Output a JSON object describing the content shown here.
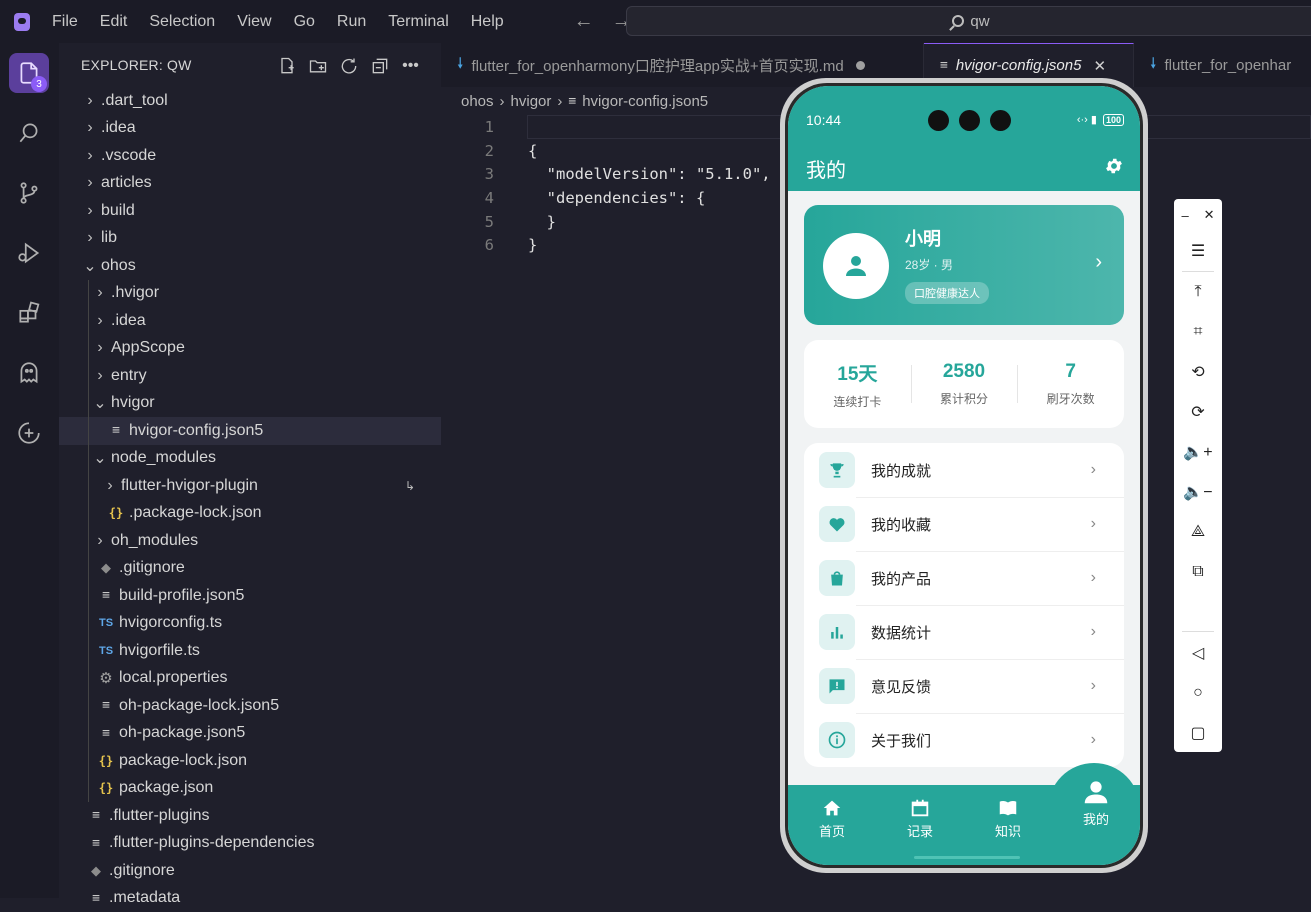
{
  "menubar": [
    "File",
    "Edit",
    "Selection",
    "View",
    "Go",
    "Run",
    "Terminal",
    "Help"
  ],
  "search": {
    "text": "qw"
  },
  "activity": {
    "badge": "3"
  },
  "explorer": {
    "title": "EXPLORER: QW",
    "items": [
      {
        "label": ".dart_tool",
        "type": "folder",
        "open": false,
        "depth": 0
      },
      {
        "label": ".idea",
        "type": "folder",
        "open": false,
        "depth": 0
      },
      {
        "label": ".vscode",
        "type": "folder",
        "open": false,
        "depth": 0
      },
      {
        "label": "articles",
        "type": "folder",
        "open": false,
        "depth": 0
      },
      {
        "label": "build",
        "type": "folder",
        "open": false,
        "depth": 0
      },
      {
        "label": "lib",
        "type": "folder",
        "open": false,
        "depth": 0
      },
      {
        "label": "ohos",
        "type": "folder",
        "open": true,
        "depth": 0
      },
      {
        "label": ".hvigor",
        "type": "folder",
        "open": false,
        "depth": 1
      },
      {
        "label": ".idea",
        "type": "folder",
        "open": false,
        "depth": 1
      },
      {
        "label": "AppScope",
        "type": "folder",
        "open": false,
        "depth": 1
      },
      {
        "label": "entry",
        "type": "folder",
        "open": false,
        "depth": 1
      },
      {
        "label": "hvigor",
        "type": "folder",
        "open": true,
        "depth": 1
      },
      {
        "label": "hvigor-config.json5",
        "type": "lines",
        "depth": 2,
        "selected": true
      },
      {
        "label": "node_modules",
        "type": "folder",
        "open": true,
        "depth": 1
      },
      {
        "label": "flutter-hvigor-plugin",
        "type": "folder",
        "open": false,
        "depth": 2,
        "link": true
      },
      {
        "label": ".package-lock.json",
        "type": "braces",
        "depth": 2
      },
      {
        "label": "oh_modules",
        "type": "folder",
        "open": false,
        "depth": 1
      },
      {
        "label": ".gitignore",
        "type": "git",
        "depth": 1
      },
      {
        "label": "build-profile.json5",
        "type": "lines",
        "depth": 1
      },
      {
        "label": "hvigorconfig.ts",
        "type": "ts",
        "depth": 1
      },
      {
        "label": "hvigorfile.ts",
        "type": "ts",
        "depth": 1
      },
      {
        "label": "local.properties",
        "type": "gear",
        "depth": 1
      },
      {
        "label": "oh-package-lock.json5",
        "type": "lines",
        "depth": 1
      },
      {
        "label": "oh-package.json5",
        "type": "lines",
        "depth": 1
      },
      {
        "label": "package-lock.json",
        "type": "braces",
        "depth": 1
      },
      {
        "label": "package.json",
        "type": "braces",
        "depth": 1
      },
      {
        "label": ".flutter-plugins",
        "type": "lines",
        "depth": 0
      },
      {
        "label": ".flutter-plugins-dependencies",
        "type": "lines",
        "depth": 0
      },
      {
        "label": ".gitignore",
        "type": "git",
        "depth": 0
      },
      {
        "label": ".metadata",
        "type": "lines",
        "depth": 0
      }
    ]
  },
  "tabs": [
    {
      "label": "flutter_for_openharmony口腔护理app实战+首页实现.md",
      "modified": true,
      "active": false
    },
    {
      "label": "hvigor-config.json5",
      "modified": false,
      "active": true
    },
    {
      "label": "flutter_for_openhar",
      "modified": false,
      "active": false
    }
  ],
  "breadcrumb": [
    "ohos",
    "hvigor",
    "hvigor-config.json5"
  ],
  "code": {
    "lines": [
      "",
      "{",
      "  \"modelVersion\": \"5.1.0\",",
      "  \"dependencies\": {",
      "  }",
      "}"
    ]
  },
  "phone": {
    "time": "10:44",
    "battery": "100",
    "appbar_title": "我的",
    "profile": {
      "name": "小明",
      "info": "28岁 · 男",
      "tag": "口腔健康达人"
    },
    "stats": [
      {
        "value": "15天",
        "label": "连续打卡"
      },
      {
        "value": "2580",
        "label": "累计积分"
      },
      {
        "value": "7",
        "label": "刷牙次数"
      }
    ],
    "menu": [
      {
        "label": "我的成就",
        "icon": "trophy-icon"
      },
      {
        "label": "我的收藏",
        "icon": "heart-icon"
      },
      {
        "label": "我的产品",
        "icon": "shopping-bag-icon"
      },
      {
        "label": "数据统计",
        "icon": "bar-chart-icon"
      },
      {
        "label": "意见反馈",
        "icon": "feedback-icon"
      },
      {
        "label": "关于我们",
        "icon": "info-icon"
      }
    ],
    "nav": [
      {
        "label": "首页",
        "icon": "home-icon"
      },
      {
        "label": "记录",
        "icon": "calendar-icon"
      },
      {
        "label": "知识",
        "icon": "book-icon"
      },
      {
        "label": "我的",
        "icon": "person-icon",
        "active": true
      }
    ],
    "accent": "#26a69a"
  }
}
